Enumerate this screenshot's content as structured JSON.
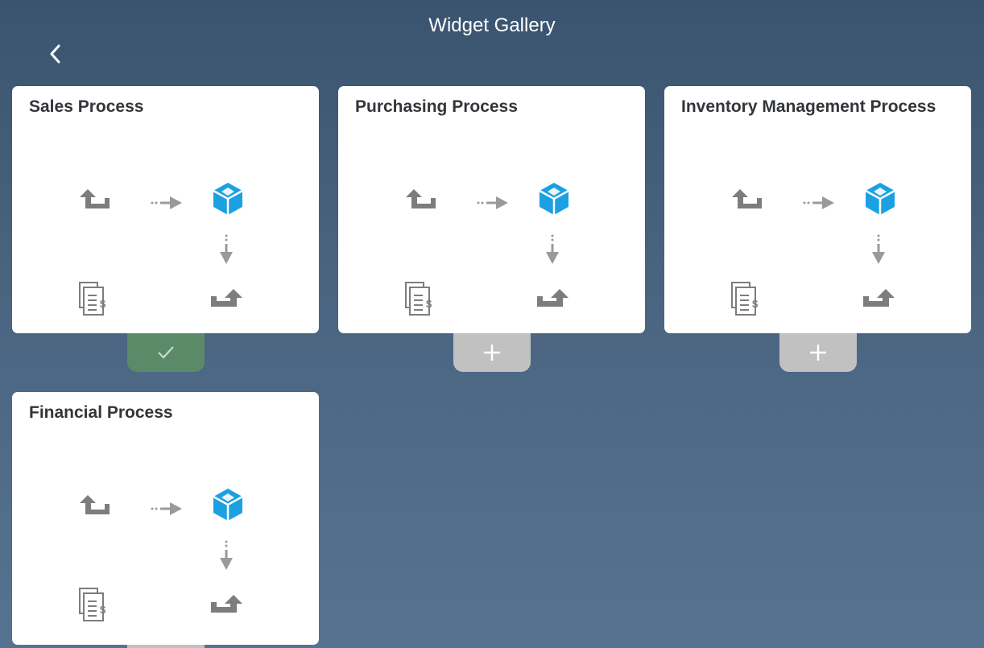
{
  "header": {
    "title": "Widget Gallery",
    "back_icon": "chevron-left-icon"
  },
  "colors": {
    "background_top": "#3a5470",
    "background_bottom": "#557390",
    "card": "#ffffff",
    "added_tab": "#5a8a68",
    "add_tab": "#c1c1c1",
    "cube_blue": "#1ba1e2",
    "flow_gray": "#7d7d7d"
  },
  "widgets": [
    {
      "title": "Sales Process",
      "state": "added",
      "action_icon": "checkmark-icon"
    },
    {
      "title": "Purchasing Process",
      "state": "available",
      "action_icon": "plus-icon"
    },
    {
      "title": "Inventory Management Process",
      "state": "available",
      "action_icon": "plus-icon"
    },
    {
      "title": "Financial Process",
      "state": "available",
      "action_icon": "plus-icon"
    }
  ],
  "flow_icons": [
    "return-arrow-icon",
    "dotted-arrow-right-icon",
    "blue-cube-icon",
    "dotted-arrow-down-icon",
    "invoice-document-icon",
    "export-arrow-icon"
  ]
}
